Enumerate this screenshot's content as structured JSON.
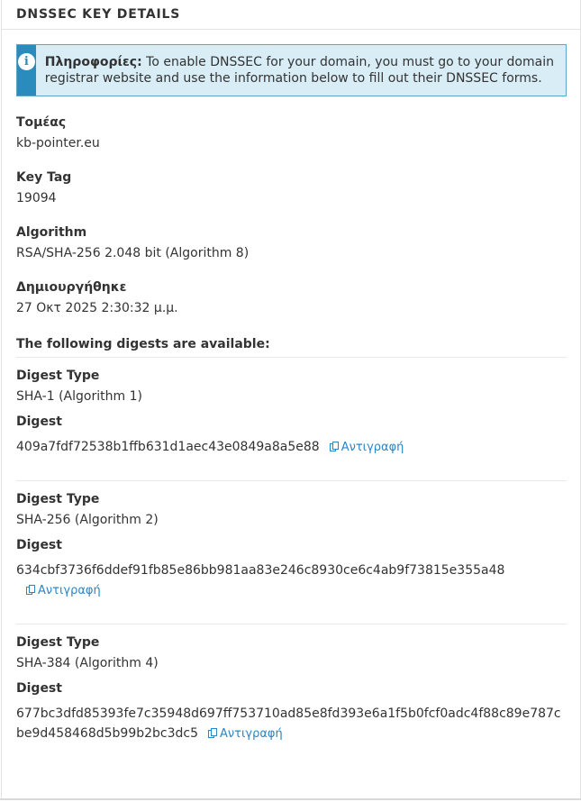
{
  "panel": {
    "title": "DNSSEC KEY DETAILS"
  },
  "alert": {
    "icon": "info-icon",
    "label": "Πληροφορίες:",
    "text": "To enable DNSSEC for your domain, you must go to your domain registrar website and use the information below to fill out their DNSSEC forms."
  },
  "fields": {
    "domain": {
      "label": "Τομέας",
      "value": "kb-pointer.eu"
    },
    "key_tag": {
      "label": "Key Tag",
      "value": "19094"
    },
    "algorithm": {
      "label": "Algorithm",
      "value": "RSA/SHA-256 2.048 bit (Algorithm 8)"
    },
    "created": {
      "label": "Δημιουργήθηκε",
      "value": "27 Οκτ 2025 2:30:32 μ.μ."
    }
  },
  "digests_heading": "The following digests are available:",
  "digest_type_label": "Digest Type",
  "digest_label": "Digest",
  "copy_label": "Αντιγραφή",
  "digests": [
    {
      "type": "SHA-1 (Algorithm 1)",
      "value": "409a7fdf72538b1ffb631d1aec43e0849a8a5e88"
    },
    {
      "type": "SHA-256 (Algorithm 2)",
      "value": "634cbf3736f6ddef91fb85e86bb981aa83e246c8930ce6c4ab9f73815e355a48"
    },
    {
      "type": "SHA-384 (Algorithm 4)",
      "value": "677bc3dfd85393fe7c35948d697ff753710ad85e8fd393e6a1f5b0fcf0adc4f88c89e787cbe9d458468d5b99b2bc3dc5"
    }
  ]
}
